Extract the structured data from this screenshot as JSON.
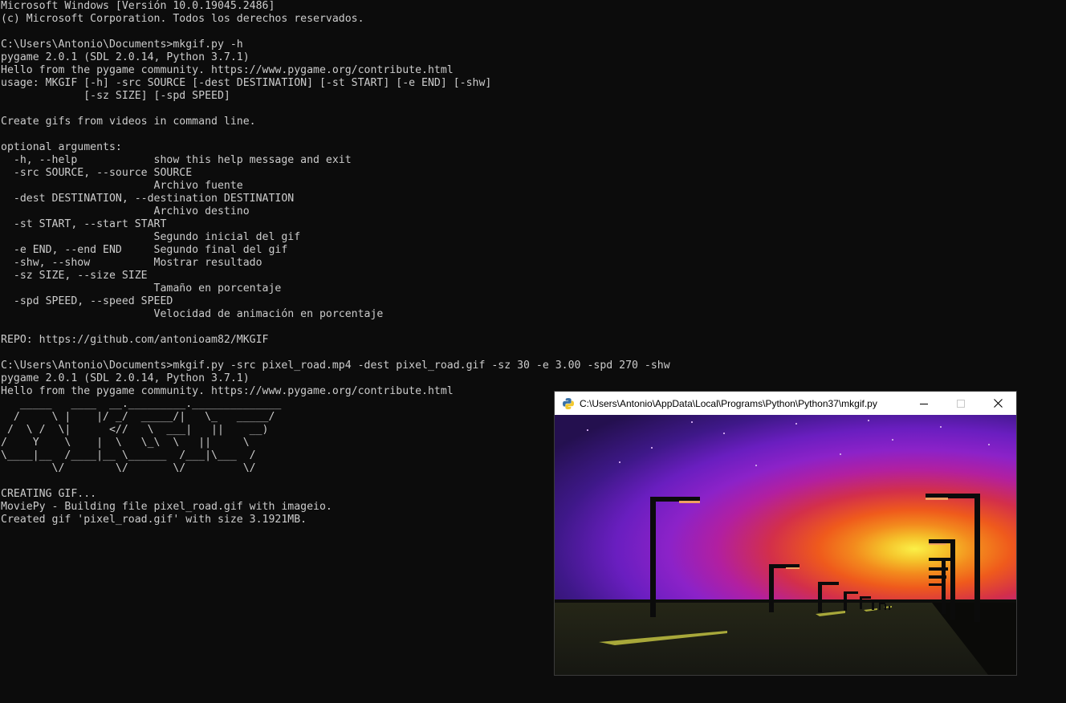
{
  "console": {
    "lines": [
      "Microsoft Windows [Versión 10.0.19045.2486]",
      "(c) Microsoft Corporation. Todos los derechos reservados.",
      "",
      "C:\\Users\\Antonio\\Documents>mkgif.py -h",
      "pygame 2.0.1 (SDL 2.0.14, Python 3.7.1)",
      "Hello from the pygame community. https://www.pygame.org/contribute.html",
      "usage: MKGIF [-h] -src SOURCE [-dest DESTINATION] [-st START] [-e END] [-shw]",
      "             [-sz SIZE] [-spd SPEED]",
      "",
      "Create gifs from videos in command line.",
      "",
      "optional arguments:",
      "  -h, --help            show this help message and exit",
      "  -src SOURCE, --source SOURCE",
      "                        Archivo fuente",
      "  -dest DESTINATION, --destination DESTINATION",
      "                        Archivo destino",
      "  -st START, --start START",
      "                        Segundo inicial del gif",
      "  -e END, --end END     Segundo final del gif",
      "  -shw, --show          Mostrar resultado",
      "  -sz SIZE, --size SIZE",
      "                        Tamaño en porcentaje",
      "  -spd SPEED, --speed SPEED",
      "                        Velocidad de animación en porcentaje",
      "",
      "REPO: https://github.com/antonioam82/MKGIF",
      "",
      "C:\\Users\\Antonio\\Documents>mkgif.py -src pixel_road.mp4 -dest pixel_road.gif -sz 30 -e 3.00 -spd 270 -shw",
      "pygame 2.0.1 (SDL 2.0.14, Python 3.7.1)",
      "Hello from the pygame community. https://www.pygame.org/contribute.html",
      "   _____   ____  __._________.______________",
      "  /     \\ |    |/ _/  _____/|   \\_   _____/",
      " /  \\ /  \\|      <//   \\  ___|   ||    __)",
      "/    Y    \\    |  \\   \\_\\  \\   ||     \\",
      "\\____|__  /____|__ \\______  /___|\\___  /",
      "        \\/        \\/       \\/         \\/",
      "",
      "CREATING GIF...",
      "MoviePy - Building file pixel_road.gif with imageio.",
      "Created gif 'pixel_road.gif' with size 3.1921MB."
    ]
  },
  "preview_window": {
    "title": "C:\\Users\\Antonio\\AppData\\Local\\Programs\\Python\\Python37\\mkgif.py",
    "icon": "python-icon",
    "controls": [
      "minimize-icon",
      "maximize-icon",
      "close-icon"
    ]
  },
  "colors": {
    "console_bg": "#0c0c0c",
    "console_fg": "#cccccc",
    "sky_top": "#2a1460",
    "sky_purple": "#5a1fb0",
    "sky_violet": "#8a24c8",
    "sky_magenta": "#c0259a",
    "sky_orange": "#f05a1a",
    "sun": "#f6e23a",
    "ground": "#1c1e16"
  }
}
